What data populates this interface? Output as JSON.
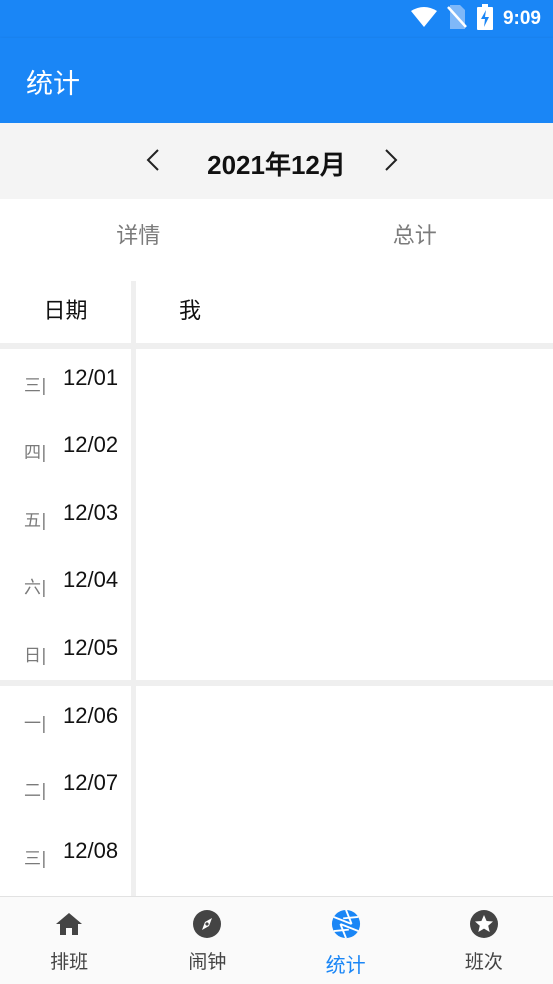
{
  "status": {
    "time": "9:09",
    "icons": [
      "wifi-icon",
      "no-sim-icon",
      "battery-charging-icon"
    ]
  },
  "appbar": {
    "title": "统计"
  },
  "month": {
    "label": "2021年12月",
    "prev_icon": "chevron-left-icon",
    "next_icon": "chevron-right-icon"
  },
  "tabs": [
    {
      "label": "详情"
    },
    {
      "label": "总计"
    }
  ],
  "table": {
    "date_header": "日期",
    "person_header": "我",
    "rows": [
      {
        "weekday": "三|",
        "date": "12/01"
      },
      {
        "weekday": "四|",
        "date": "12/02"
      },
      {
        "weekday": "五|",
        "date": "12/03"
      },
      {
        "weekday": "六|",
        "date": "12/04"
      },
      {
        "weekday": "日|",
        "date": "12/05"
      },
      {
        "weekday": "一|",
        "date": "12/06"
      },
      {
        "weekday": "二|",
        "date": "12/07"
      },
      {
        "weekday": "三|",
        "date": "12/08"
      }
    ]
  },
  "bottom_nav": [
    {
      "label": "排班",
      "icon": "home-icon"
    },
    {
      "label": "闹钟",
      "icon": "compass-icon"
    },
    {
      "label": "统计",
      "icon": "aperture-icon",
      "active": true
    },
    {
      "label": "班次",
      "icon": "star-icon"
    }
  ],
  "colors": {
    "primary": "#1a86f6",
    "divider": "#efefef",
    "muted_text": "#7b7b7b"
  }
}
